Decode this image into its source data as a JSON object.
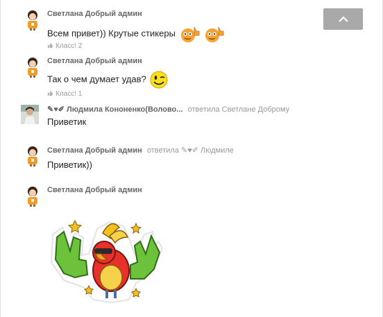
{
  "messages": [
    {
      "author": "Светлана Добрый админ",
      "text": "Всем привет)) Крутые стикеры",
      "likes_label": "Класс! 2"
    },
    {
      "author": "Светлана Добрый админ",
      "text": "Так о чем думает удав?",
      "likes_label": "Класс! 1"
    },
    {
      "author": "Людмила Кононенко(Волово...",
      "reply_to": "ответила Светлане Доброму",
      "text": "Приветик"
    },
    {
      "author": "Светлана Добрый админ",
      "reply_prefix": "ответила",
      "reply_name": "Людмиле",
      "text": "Приветик))"
    },
    {
      "author": "Светлана Добрый админ",
      "sticker": "parrot-rock-sticker"
    }
  ],
  "scroll_top": {
    "icon": "chevron-up-icon",
    "color": "#a9a9a9"
  },
  "colors": {
    "author": "#666666",
    "muted": "#999999",
    "text": "#222222",
    "avatar_shirt": "#f59a23"
  }
}
